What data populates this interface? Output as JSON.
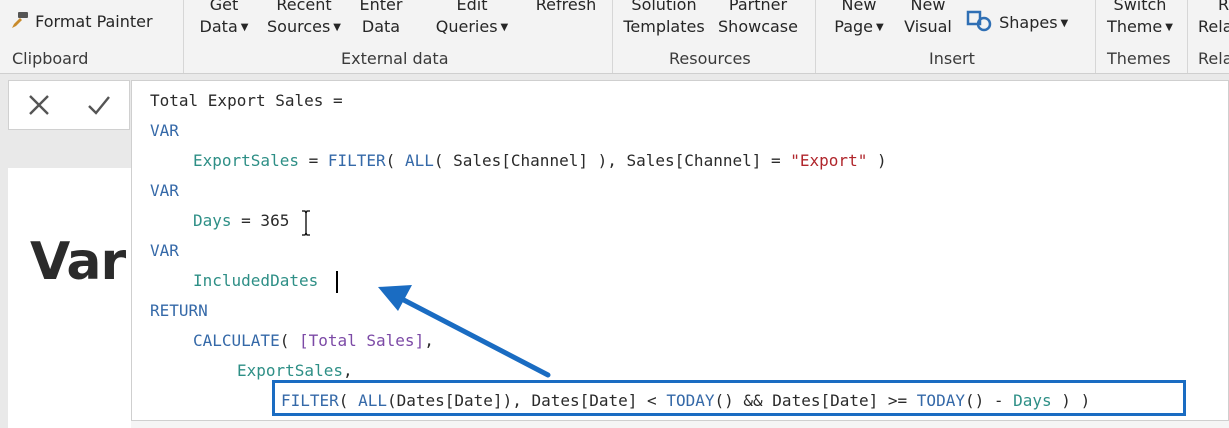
{
  "ribbon": {
    "format_painter": "Format Painter",
    "get_data": [
      "Get",
      "Data"
    ],
    "recent_sources": [
      "Recent",
      "Sources"
    ],
    "enter_data": [
      "Enter",
      "Data"
    ],
    "edit_queries": [
      "Edit",
      "Queries"
    ],
    "refresh": "Refresh",
    "solution_templates": [
      "Solution",
      "Templates"
    ],
    "partner_showcase": [
      "Partner",
      "Showcase"
    ],
    "new_page": [
      "New",
      "Page"
    ],
    "new_visual": [
      "New",
      "Visual"
    ],
    "shapes": "Shapes",
    "switch_theme": [
      "Switch",
      "Theme"
    ],
    "rel_partial": [
      "R",
      "Rela"
    ],
    "groups": {
      "clipboard": "Clipboard",
      "external_data": "External data",
      "resources": "Resources",
      "insert": "Insert",
      "themes": "Themes",
      "relationships_partial": "Rela"
    }
  },
  "formula_bar": {
    "cancel_icon": "close-icon",
    "commit_icon": "check-icon"
  },
  "canvas": {
    "title_partial": "Var"
  },
  "editor": {
    "line1": "Total Export Sales =",
    "var": "VAR",
    "l3_name": "ExportSales",
    "l3_eq": " = ",
    "l3_filter": "FILTER",
    "l3_open": "( ",
    "l3_all": "ALL",
    "l3_args": "( Sales[Channel] ), Sales[Channel] = ",
    "l3_str": "\"Export\"",
    "l3_close": " )",
    "l5_name": "Days",
    "l5_rest": " = 365",
    "l7_name": "IncludedDates",
    "return": "RETURN",
    "l9_calc": "CALCULATE",
    "l9_open": "( ",
    "l9_measure": "[Total Sales]",
    "l9_comma": ",",
    "l10_name": "ExportSales",
    "l10_comma": ",",
    "l11_filter": "FILTER",
    "l11_open": "( ",
    "l11_all": "ALL",
    "l11_mid": "(Dates[Date]), Dates[Date] < ",
    "l11_today": "TODAY",
    "l11_and": "() && Dates[Date] >= ",
    "l11_today2": "TODAY",
    "l11_minus": "() - ",
    "l11_days": "Days",
    "l11_close": " )",
    "l11_close2": " )"
  },
  "colors": {
    "highlight_border": "#1a6cc2",
    "arrow": "#1a6cc2",
    "keyword": "#3569a8",
    "variable": "#2e8f86",
    "string": "#b0262c"
  }
}
